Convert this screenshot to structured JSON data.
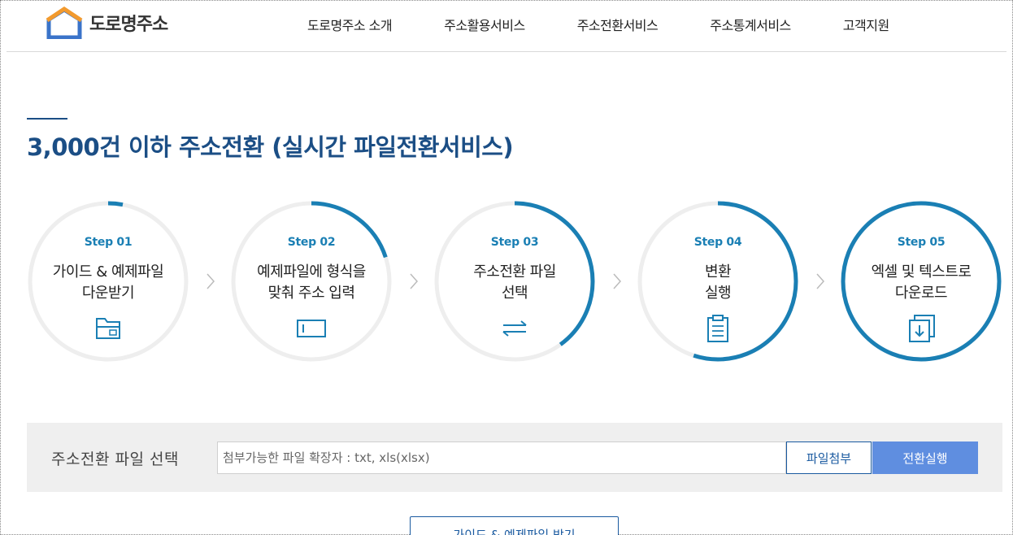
{
  "header": {
    "logo_text": "도로명주소",
    "nav": [
      {
        "label": "도로명주소 소개"
      },
      {
        "label": "주소활용서비스"
      },
      {
        "label": "주소전환서비스"
      },
      {
        "label": "주소통계서비스"
      },
      {
        "label": "고객지원"
      }
    ]
  },
  "page": {
    "title": "3,000건 이하 주소전환 (실시간 파일전환서비스)"
  },
  "steps": [
    {
      "num": "Step 01",
      "line1": "가이드 & 예제파일",
      "line2": "다운받기",
      "icon": "folder-icon",
      "progress": 0.03
    },
    {
      "num": "Step 02",
      "line1": "예제파일에 형식을",
      "line2": "맞춰 주소 입력",
      "icon": "input-box-icon",
      "progress": 0.2
    },
    {
      "num": "Step 03",
      "line1": "주소전환 파일",
      "line2": "선택",
      "icon": "swap-arrows-icon",
      "progress": 0.4
    },
    {
      "num": "Step 04",
      "line1": "변환",
      "line2": "실행",
      "icon": "clipboard-icon",
      "progress": 0.55
    },
    {
      "num": "Step 05",
      "line1": "엑셀 및 텍스트로",
      "line2": "다운로드",
      "icon": "download-file-icon",
      "progress": 1.0
    }
  ],
  "file_panel": {
    "label": "주소전환 파일 선택",
    "input_placeholder": "첨부가능한 파일 확장자 : txt, xls(xlsx)",
    "attach_button": "파일첨부",
    "run_button": "전환실행"
  },
  "bottom": {
    "guide_button": "가이드 & 예제파일 받기"
  },
  "colors": {
    "accent_blue": "#1a7fb4",
    "title_blue": "#1b4e85",
    "button_blue": "#5f8ee0",
    "ring_gray": "#eeeeee"
  }
}
